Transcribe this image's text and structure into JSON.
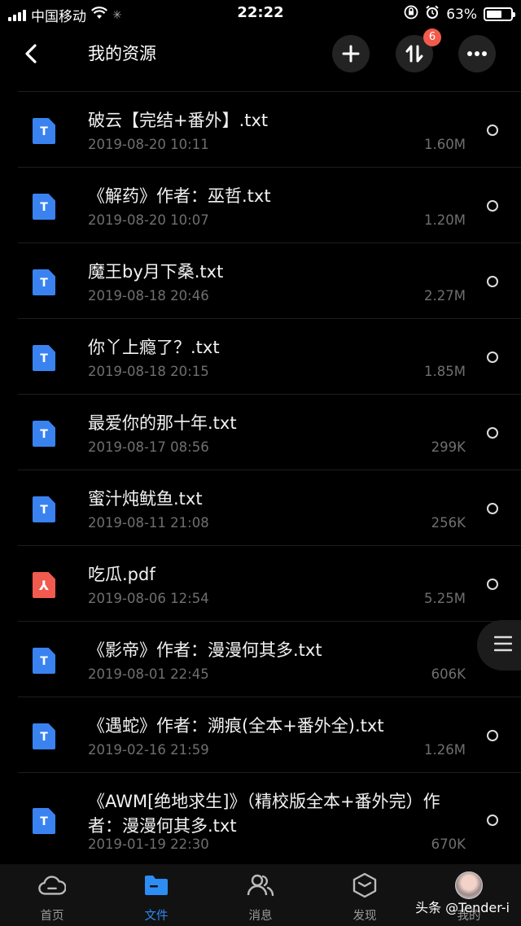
{
  "status_bar": {
    "carrier": "中国移动",
    "time": "22:22",
    "battery": "63%",
    "battery_level": 0.63
  },
  "header": {
    "title": "我的资源",
    "badge_count": "6"
  },
  "files": [
    {
      "name": "破云【完结+番外】.txt",
      "date": "2019-08-20 10:11",
      "size": "1.60M",
      "type": "txt",
      "icon_letter": "T"
    },
    {
      "name": "《解药》作者：巫哲.txt",
      "date": "2019-08-20 10:07",
      "size": "1.20M",
      "type": "txt",
      "icon_letter": "T"
    },
    {
      "name": "魔王by月下桑.txt",
      "date": "2019-08-18 20:46",
      "size": "2.27M",
      "type": "txt",
      "icon_letter": "T"
    },
    {
      "name": "你丫上瘾了？.txt",
      "date": "2019-08-18 20:15",
      "size": "1.85M",
      "type": "txt",
      "icon_letter": "T"
    },
    {
      "name": "最爱你的那十年.txt",
      "date": "2019-08-17 08:56",
      "size": "299K",
      "type": "txt",
      "icon_letter": "T"
    },
    {
      "name": "蜜汁炖鱿鱼.txt",
      "date": "2019-08-11 21:08",
      "size": "256K",
      "type": "txt",
      "icon_letter": "T"
    },
    {
      "name": "吃瓜.pdf",
      "date": "2019-08-06 12:54",
      "size": "5.25M",
      "type": "pdf",
      "icon_letter": "⅄"
    },
    {
      "name": "《影帝》作者：漫漫何其多.txt",
      "date": "2019-08-01 22:45",
      "size": "606K",
      "type": "txt",
      "icon_letter": "T"
    },
    {
      "name": "《遇蛇》作者：溯痕(全本+番外全).txt",
      "date": "2019-02-16 21:59",
      "size": "1.26M",
      "type": "txt",
      "icon_letter": "T"
    },
    {
      "name": "《AWM[绝地求生]》（精校版全本+番外完）作者：漫漫何其多.txt",
      "date": "2019-01-19 22:30",
      "size": "670K",
      "type": "txt",
      "icon_letter": "T"
    }
  ],
  "tabs": [
    {
      "label": "首页",
      "icon": "cloud-icon"
    },
    {
      "label": "文件",
      "icon": "folder-icon",
      "active": true
    },
    {
      "label": "消息",
      "icon": "people-icon"
    },
    {
      "label": "发现",
      "icon": "box-icon"
    },
    {
      "label": "我的",
      "icon": "avatar"
    }
  ],
  "watermark": "头条 @Tender-i",
  "colors": {
    "accent": "#2e8cf5",
    "txt_icon": "#3a82f0",
    "pdf_icon": "#f05a4f",
    "badge": "#f25b4b"
  }
}
